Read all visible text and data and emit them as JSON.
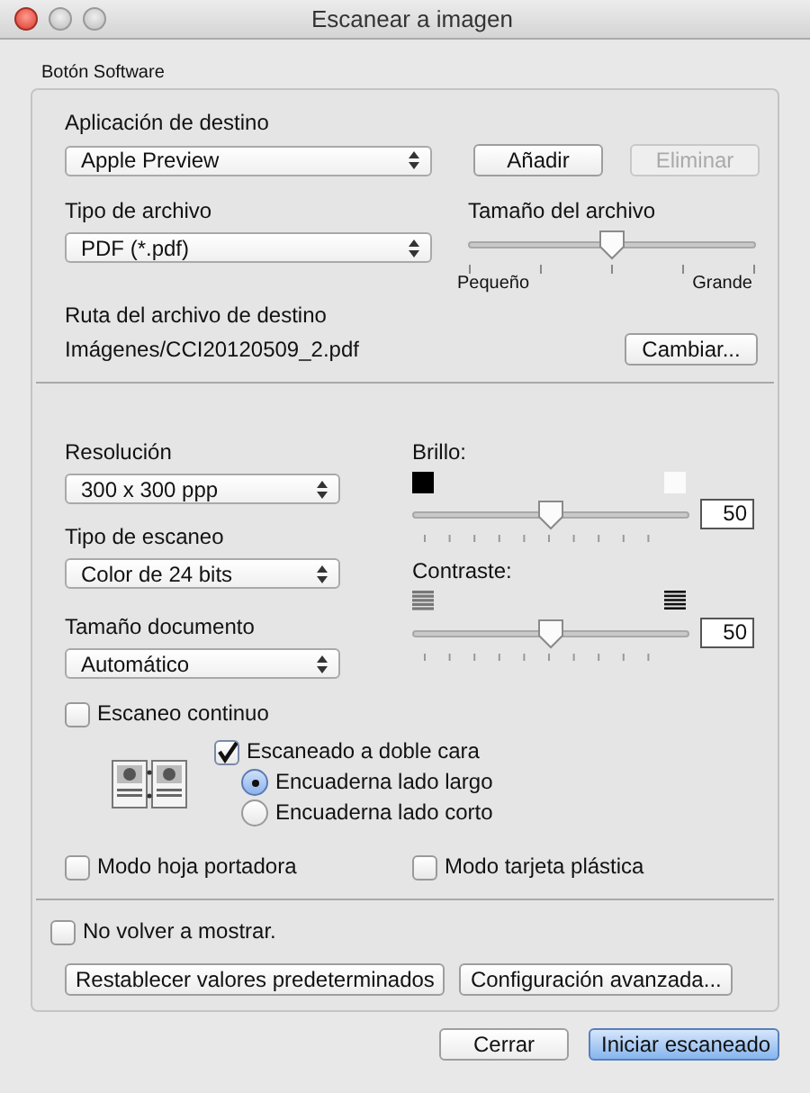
{
  "window": {
    "title": "Escanear a imagen"
  },
  "group": {
    "label": "Botón Software"
  },
  "destination": {
    "app_label": "Aplicación de destino",
    "app_value": "Apple Preview",
    "buttons": [
      {
        "label": "Añadir",
        "disabled": false
      },
      {
        "label": "Eliminar",
        "disabled": true
      }
    ],
    "file_type_label": "Tipo de archivo",
    "file_type_value": "PDF (*.pdf)",
    "file_size": {
      "label": "Tamaño del archivo",
      "level": 0.5,
      "min_label": "Pequeño",
      "max_label": "Grande"
    },
    "path_label": "Ruta del archivo de destino",
    "path_value": "Imágenes/CCI20120509_2.pdf",
    "change_button": "Cambiar..."
  },
  "scan": {
    "selects": [
      {
        "label": "Resolución",
        "value": "300 x 300 ppp"
      },
      {
        "label": "Tipo de escaneo",
        "value": "Color de 24 bits"
      },
      {
        "label": "Tamaño documento",
        "value": "Automático"
      }
    ],
    "adjust": [
      {
        "kind": "brightness",
        "label": "Brillo:",
        "level": 0.5,
        "value": "50"
      },
      {
        "kind": "contrast",
        "label": "Contraste:",
        "level": 0.5,
        "value": "50"
      }
    ],
    "continuous": {
      "label": "Escaneo continuo",
      "checked": false
    },
    "duplex": {
      "label": "Escaneado a doble cara",
      "checked": true
    },
    "binding": [
      {
        "label": "Encuaderna lado largo",
        "selected": true
      },
      {
        "label": "Encuaderna lado corto",
        "selected": false
      }
    ],
    "modes": [
      {
        "label": "Modo hoja portadora",
        "checked": false
      },
      {
        "label": "Modo tarjeta plástica",
        "checked": false
      }
    ]
  },
  "dont_show": {
    "label": "No volver a mostrar.",
    "checked": false
  },
  "group_buttons": [
    "Restablecer valores predeterminados",
    "Configuración avanzada..."
  ],
  "dialog_buttons": [
    {
      "label": "Cerrar",
      "default": false
    },
    {
      "label": "Iniciar escaneado",
      "default": true
    }
  ]
}
